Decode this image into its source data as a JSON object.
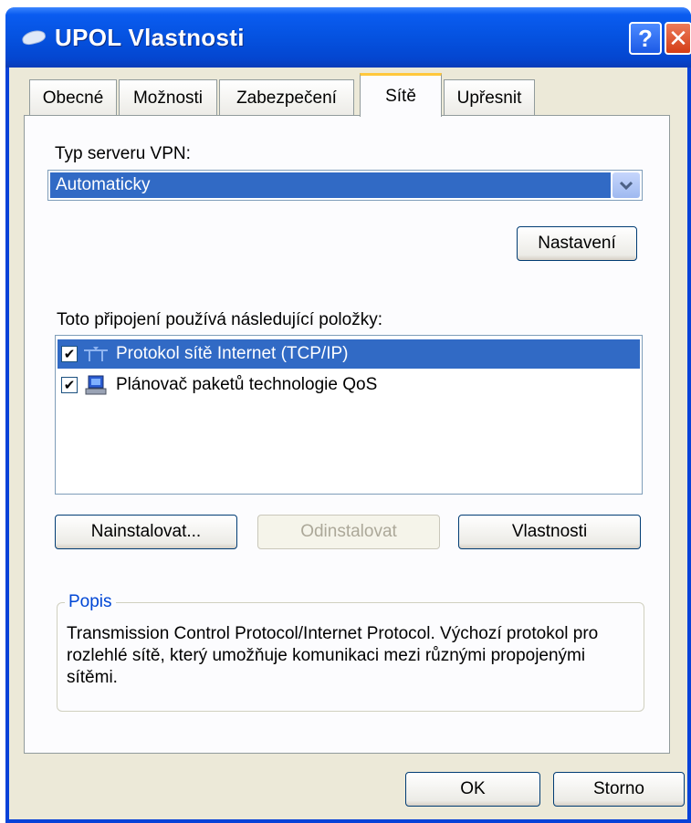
{
  "window": {
    "title": "UPOL Vlastnosti",
    "help_label": "?",
    "close_label": "✕"
  },
  "tabs": [
    {
      "label": "Obecné"
    },
    {
      "label": "Možnosti"
    },
    {
      "label": "Zabezpečení"
    },
    {
      "label": "Sítě"
    },
    {
      "label": "Upřesnit"
    }
  ],
  "active_tab": "Sítě",
  "vpn": {
    "label": "Typ serveru VPN:",
    "selected": "Automaticky"
  },
  "buttons": {
    "settings": "Nastavení",
    "install": "Nainstalovat...",
    "uninstall": "Odinstalovat",
    "properties": "Vlastnosti",
    "ok": "OK",
    "cancel": "Storno"
  },
  "components": {
    "label": "Toto připojení používá následující položky:",
    "items": [
      {
        "label": "Protokol sítě Internet (TCP/IP)",
        "checked": true,
        "selected": true,
        "icon": "network-protocol-icon"
      },
      {
        "label": "Plánovač paketů technologie QoS",
        "checked": true,
        "selected": false,
        "icon": "computer-service-icon"
      }
    ]
  },
  "description": {
    "legend": "Popis",
    "text": "Transmission Control Protocol/Internet Protocol. Výchozí protokol pro rozlehlé sítě, který umožňuje komunikaci mezi různými propojenými sítěmi."
  },
  "colors": {
    "titlebar": "#0552e0",
    "selection": "#316ac5",
    "dialog_bg": "#ece9d8",
    "active_tab_accent": "#ffc83c"
  }
}
